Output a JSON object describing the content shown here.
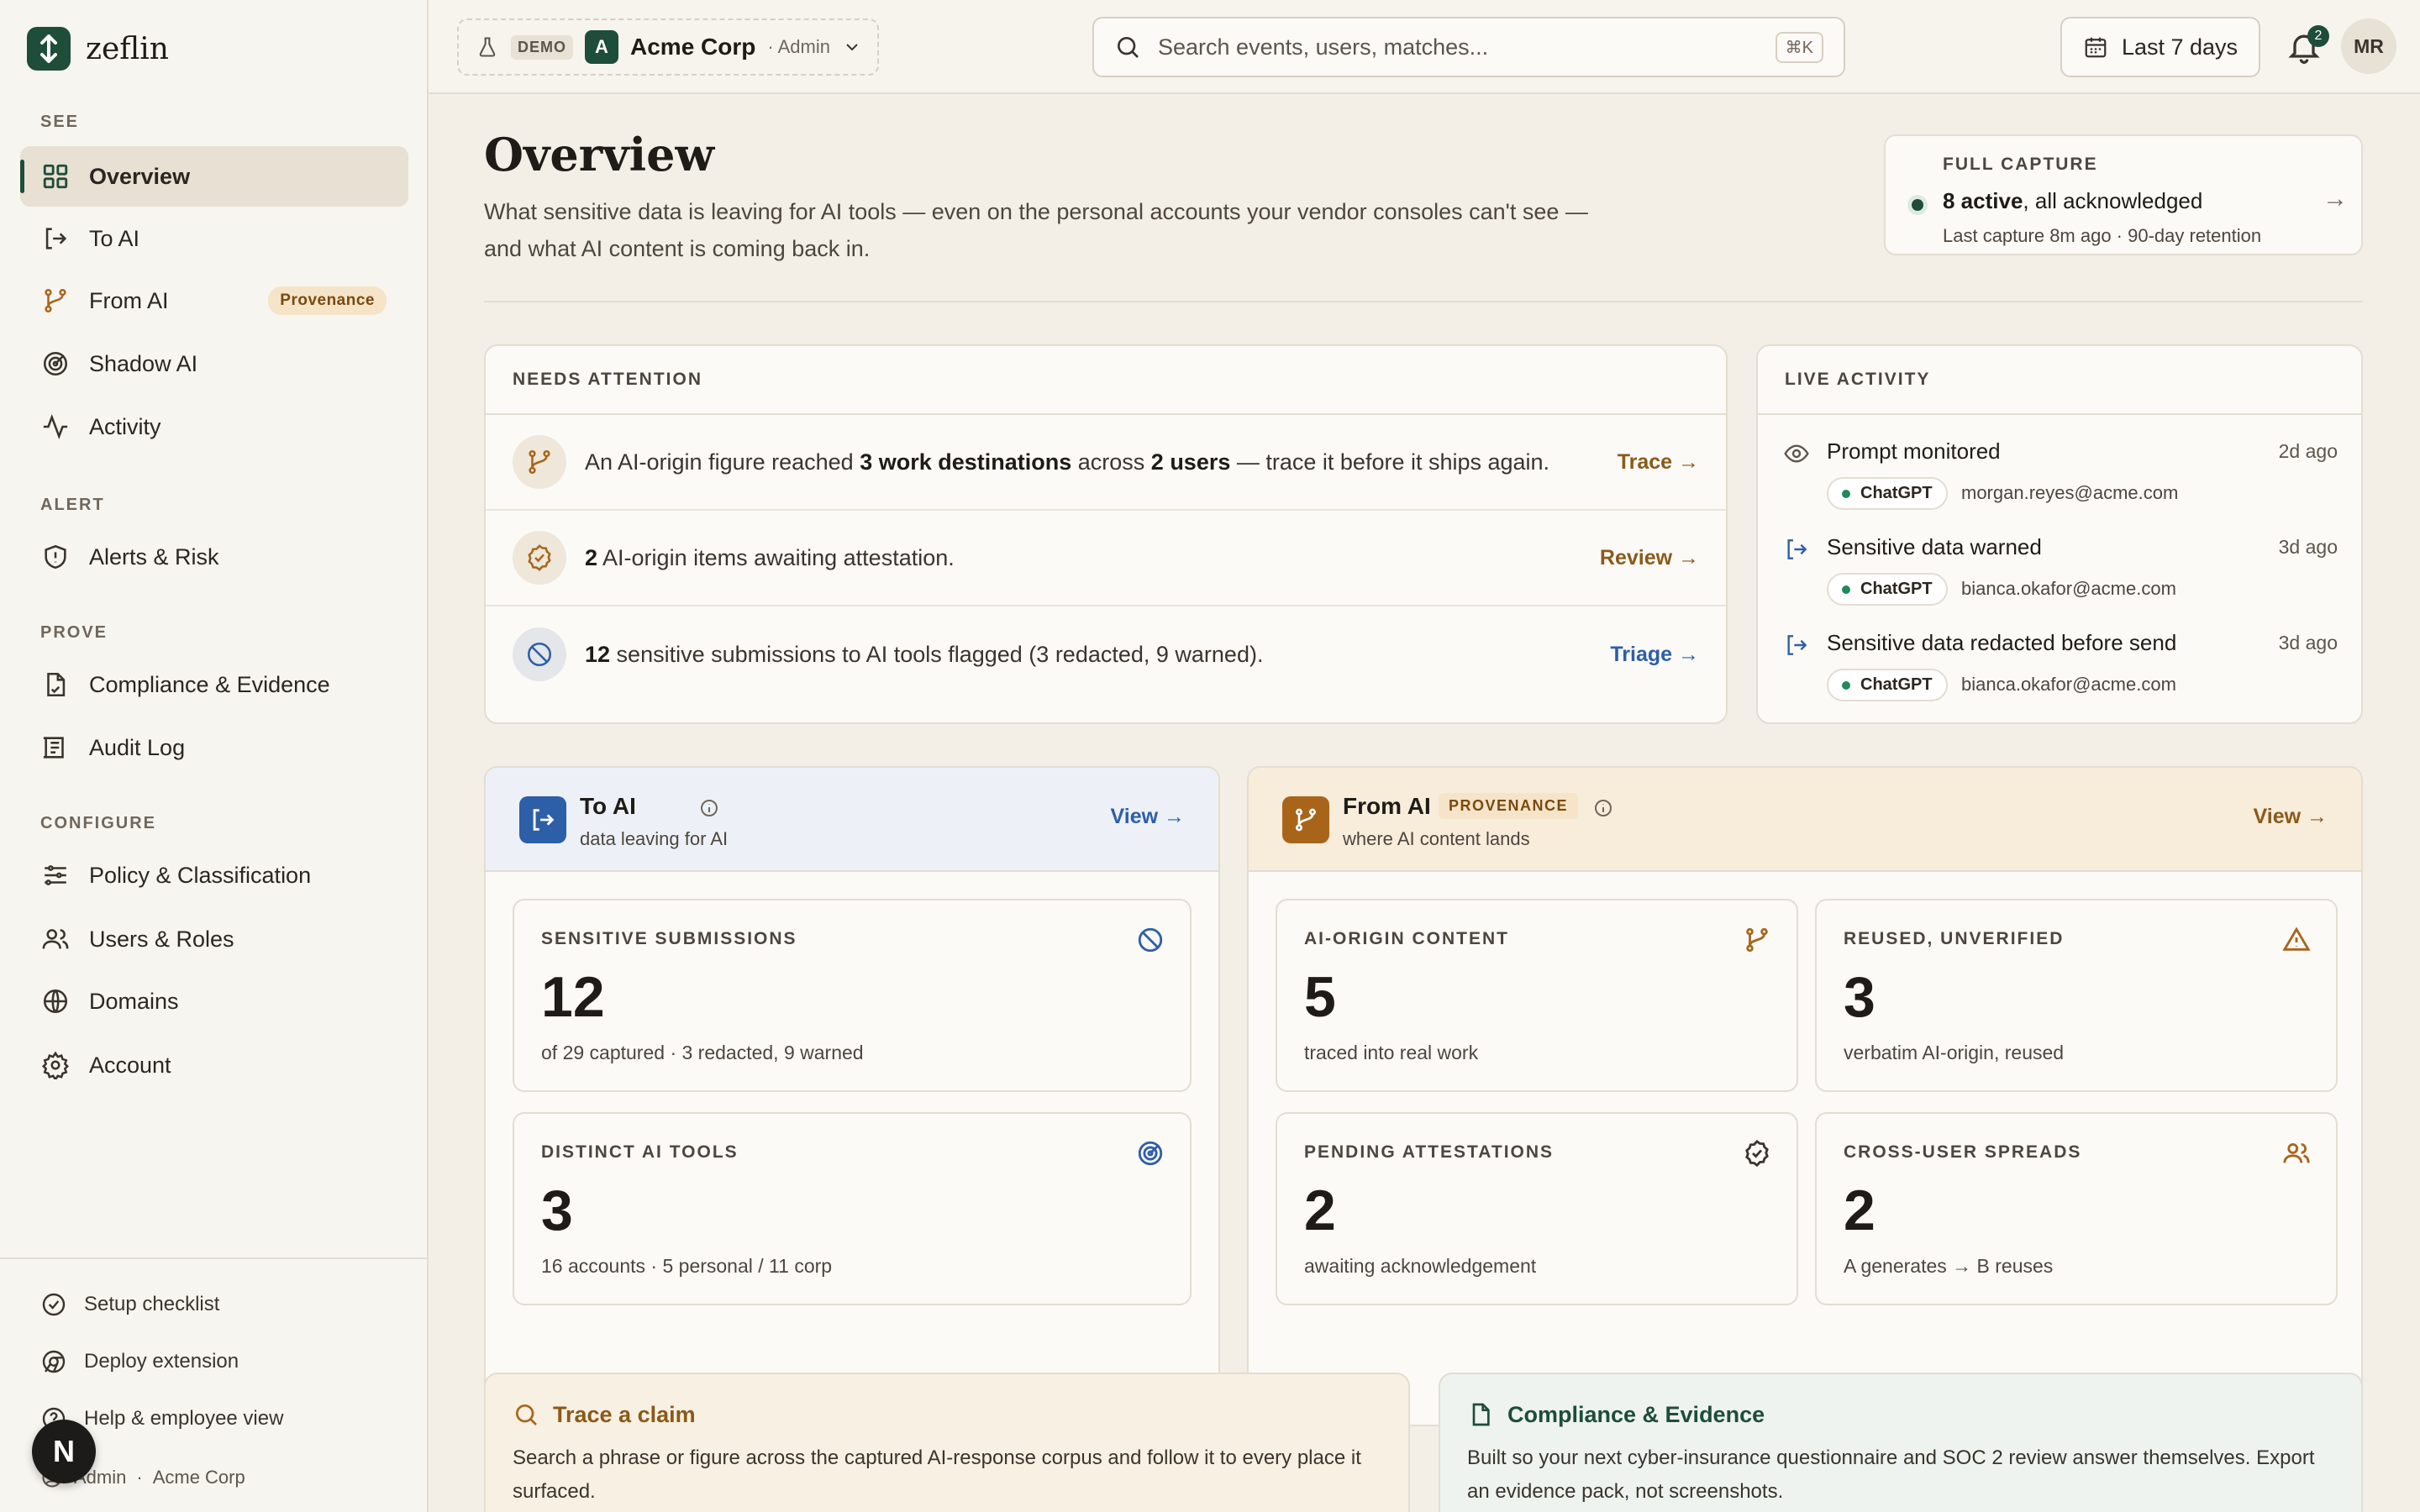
{
  "brand": {
    "name": "zeflin",
    "color": "#1e4d3a"
  },
  "sidebar": {
    "sections": [
      {
        "label": "SEE",
        "items": [
          {
            "label": "Overview",
            "icon": "grid-icon",
            "active": true
          },
          {
            "label": "To AI",
            "icon": "arrow-out-icon"
          },
          {
            "label": "From AI",
            "icon": "branch-icon",
            "badge": "Provenance"
          },
          {
            "label": "Shadow AI",
            "icon": "radar-icon"
          },
          {
            "label": "Activity",
            "icon": "pulse-icon"
          }
        ]
      },
      {
        "label": "ALERT",
        "items": [
          {
            "label": "Alerts & Risk",
            "icon": "shield-icon"
          }
        ]
      },
      {
        "label": "PROVE",
        "items": [
          {
            "label": "Compliance & Evidence",
            "icon": "document-icon"
          },
          {
            "label": "Audit Log",
            "icon": "log-icon"
          }
        ]
      },
      {
        "label": "CONFIGURE",
        "items": [
          {
            "label": "Policy & Classification",
            "icon": "sliders-icon"
          },
          {
            "label": "Users & Roles",
            "icon": "users-icon"
          },
          {
            "label": "Domains",
            "icon": "globe-icon"
          },
          {
            "label": "Account",
            "icon": "gear-icon"
          }
        ]
      }
    ],
    "footer": {
      "setup": "Setup checklist",
      "deploy": "Deploy extension",
      "help": "Help & employee view",
      "role": "Admin",
      "sep": "·",
      "org": "Acme Corp"
    },
    "fab": "N"
  },
  "topbar": {
    "demo": "DEMO",
    "org_initial": "A",
    "org_name": "Acme Corp",
    "org_role": "· Admin",
    "search_placeholder": "Search events, users, matches...",
    "search_shortcut": "⌘K",
    "range": "Last 7 days",
    "notifications": "2",
    "user_initials": "MR"
  },
  "page": {
    "title": "Overview",
    "subtitle": "What sensitive data is leaving for AI tools — even on the personal accounts your vendor consoles can't see — and what AI content is coming back in."
  },
  "capture": {
    "label": "FULL CAPTURE",
    "count": "8 active",
    "status": ", all acknowledged",
    "detail": "Last capture 8m ago · 90-day retention"
  },
  "attention": {
    "title": "NEEDS ATTENTION",
    "rows": [
      {
        "pre": "An AI-origin figure reached ",
        "b1": "3 work destinations",
        "mid": " across ",
        "b2": "2 users",
        "post": " — trace it before it ships again.",
        "action": "Trace →",
        "color": "#8a5a1a"
      },
      {
        "pre": "",
        "b1": "2",
        "mid": " AI-origin items awaiting attestation.",
        "b2": "",
        "post": "",
        "action": "Review →",
        "color": "#8a5a1a"
      },
      {
        "pre": "",
        "b1": "12",
        "mid": " sensitive submissions to AI tools flagged (3 redacted, 9 warned).",
        "b2": "",
        "post": "",
        "action": "Triage →",
        "color": "#2d5fa8"
      }
    ]
  },
  "activity": {
    "title": "LIVE ACTIVITY",
    "items": [
      {
        "title": "Prompt monitored",
        "time": "2d ago",
        "tool": "ChatGPT",
        "email": "morgan.reyes@acme.com",
        "icon": "eye-icon"
      },
      {
        "title": "Sensitive data warned",
        "time": "3d ago",
        "tool": "ChatGPT",
        "email": "bianca.okafor@acme.com",
        "icon": "arrow-out-icon"
      },
      {
        "title": "Sensitive data redacted before send",
        "time": "3d ago",
        "tool": "ChatGPT",
        "email": "bianca.okafor@acme.com",
        "icon": "arrow-out-icon"
      }
    ]
  },
  "to_ai": {
    "title": "To AI",
    "subtitle": "data leaving for AI",
    "view": "View →",
    "accent": "#2d5fa8",
    "stats": [
      {
        "label": "SENSITIVE SUBMISSIONS",
        "value": "12",
        "desc": "of 29 captured · 3 redacted, 9 warned",
        "icon": "block-icon"
      },
      {
        "label": "DISTINCT AI TOOLS",
        "value": "3",
        "desc": "16 accounts · 5 personal / 11 corp",
        "icon": "radar-icon"
      }
    ]
  },
  "from_ai": {
    "title": "From AI",
    "badge": "PROVENANCE",
    "subtitle": "where AI content lands",
    "view": "View →",
    "accent": "#8a5a1a",
    "stats": [
      {
        "label": "AI-ORIGIN CONTENT",
        "value": "5",
        "desc": "traced into real work",
        "icon": "branch-icon"
      },
      {
        "label": "REUSED, UNVERIFIED",
        "value": "3",
        "desc": "verbatim AI-origin, reused",
        "icon": "warning-icon"
      },
      {
        "label": "PENDING ATTESTATIONS",
        "value": "2",
        "desc": "awaiting acknowledgement",
        "icon": "check-circle-icon"
      },
      {
        "label": "CROSS-USER SPREADS",
        "value": "2",
        "desc": "A generates → B reuses",
        "icon": "users-icon"
      }
    ]
  },
  "bottom": {
    "trace": {
      "title": "Trace a claim",
      "text": "Search a phrase or figure across the captured AI-response corpus and follow it to every place it surfaced."
    },
    "compliance": {
      "title": "Compliance & Evidence",
      "text": "Built so your next cyber-insurance questionnaire and SOC 2 review answer themselves. Export an evidence pack, not screenshots."
    }
  }
}
